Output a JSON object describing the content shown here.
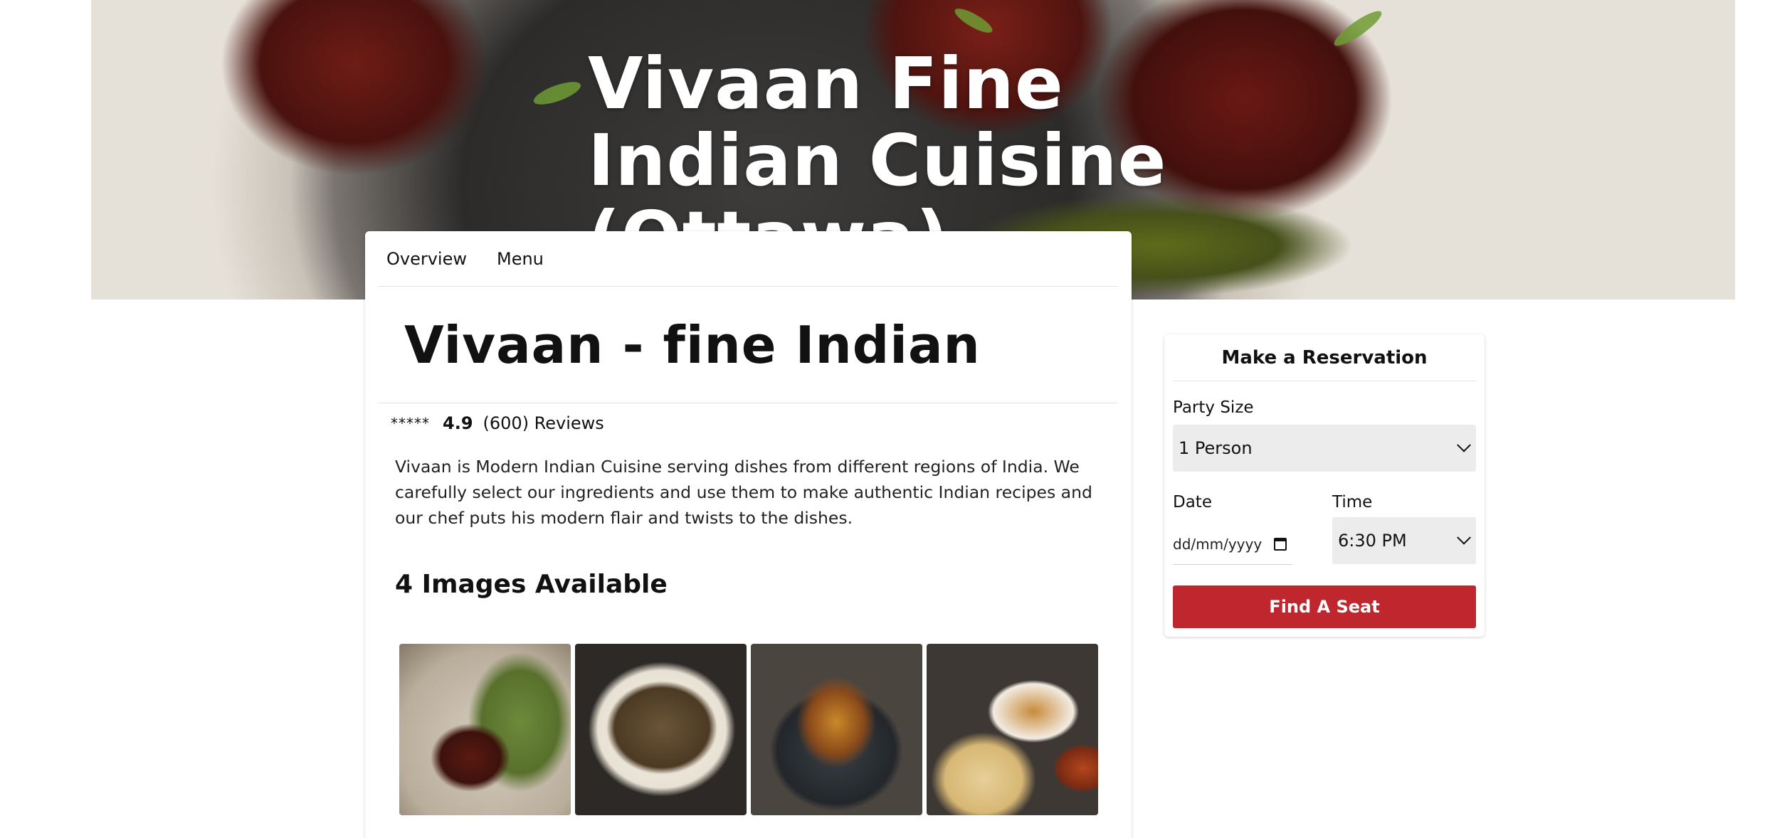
{
  "hero": {
    "title": "Vivaan Fine Indian Cuisine (Ottawa)"
  },
  "tabs": [
    {
      "label": "Overview"
    },
    {
      "label": "Menu"
    }
  ],
  "restaurant": {
    "name": "Vivaan - fine Indian",
    "stars": "*****",
    "rating": "4.9",
    "reviews": "(600) Reviews",
    "description": "Vivaan is Modern Indian Cuisine serving dishes from different regions of India. We carefully select our ingredients and use them to make authentic Indian recipes and our chef puts his modern flair and twists to the dishes."
  },
  "gallery": {
    "heading": "4 Images Available",
    "count": 4
  },
  "reservation": {
    "title": "Make a Reservation",
    "party_size_label": "Party Size",
    "party_size_value": "1 Person",
    "date_label": "Date",
    "date_placeholder": "dd/mm/yyyy",
    "time_label": "Time",
    "time_value": "6:30 PM",
    "button_label": "Find A Seat"
  },
  "colors": {
    "accent": "#c0262d",
    "select_bg": "#ececec"
  }
}
